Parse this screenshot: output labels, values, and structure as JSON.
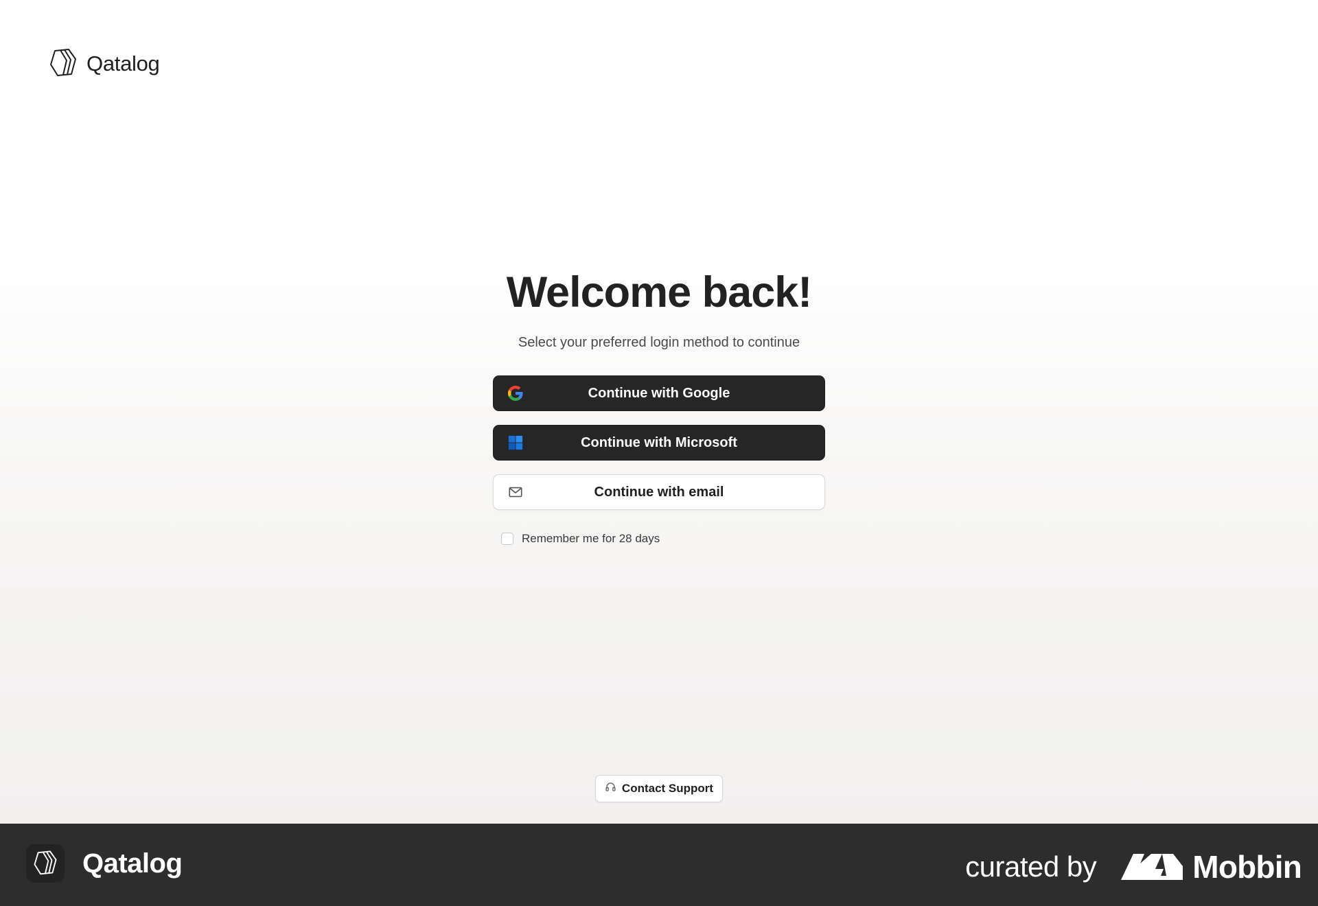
{
  "app": {
    "name": "Qatalog"
  },
  "login": {
    "title": "Welcome back!",
    "subtitle": "Select your preferred login method to continue",
    "google_label": "Continue with Google",
    "microsoft_label": "Continue with Microsoft",
    "email_label": "Continue with email",
    "remember_label": "Remember me for 28 days",
    "remember_checked": false
  },
  "support": {
    "label": "Contact Support"
  },
  "footer": {
    "app_name": "Qatalog",
    "curated_label": "curated by",
    "brand": "Mobbin"
  },
  "colors": {
    "dark_button": "#262626",
    "footer_bg": "#2d2d2d",
    "google_blue": "#4285F4",
    "google_red": "#EA4335",
    "google_yellow": "#FBBC05",
    "google_green": "#34A853",
    "microsoft_blue": "#0078D4"
  },
  "icons": [
    "qatalog-logo-icon",
    "google-icon",
    "microsoft-icon",
    "mail-icon",
    "headset-icon",
    "mobbin-logo-icon"
  ]
}
